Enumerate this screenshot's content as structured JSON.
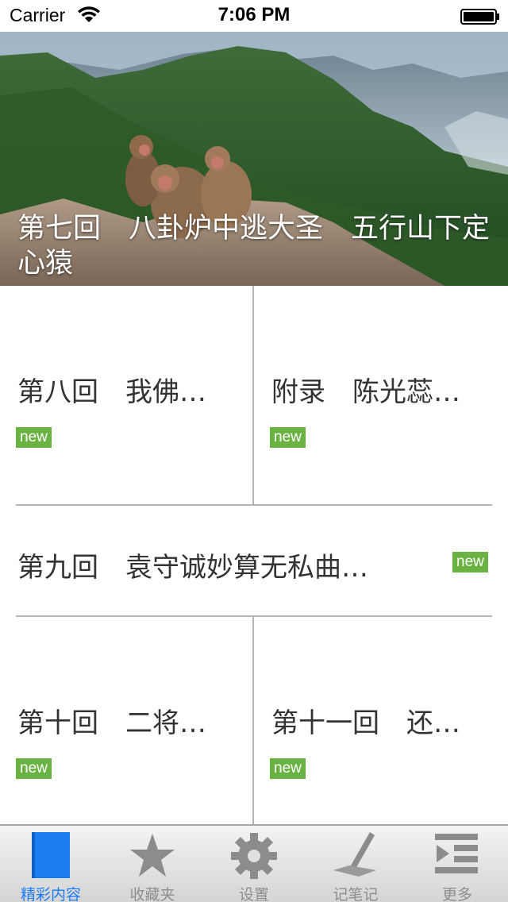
{
  "status_bar": {
    "carrier": "Carrier",
    "time": "7:06 PM"
  },
  "hero": {
    "title": "第七回　八卦炉中逃大圣　五行山下定心猿"
  },
  "items": [
    {
      "title": "第八回　我佛…",
      "badge": "new"
    },
    {
      "title": "附录　陈光蕊…",
      "badge": "new"
    },
    {
      "title": "第九回　袁守诚妙算无私曲…",
      "badge": "new"
    },
    {
      "title": "第十回　二将…",
      "badge": "new"
    },
    {
      "title": "第十一回　还…",
      "badge": "new"
    }
  ],
  "tab_bar": {
    "tabs": [
      {
        "label": "精彩内容",
        "icon": "book-icon",
        "active": true
      },
      {
        "label": "收藏夹",
        "icon": "star-icon",
        "active": false
      },
      {
        "label": "设置",
        "icon": "gear-icon",
        "active": false
      },
      {
        "label": "记笔记",
        "icon": "pen-icon",
        "active": false
      },
      {
        "label": "更多",
        "icon": "more-icon",
        "active": false
      }
    ]
  },
  "colors": {
    "badge": "#6ab343",
    "active_tab": "#1a7cf0",
    "inactive_tab": "#8e8e8e"
  }
}
